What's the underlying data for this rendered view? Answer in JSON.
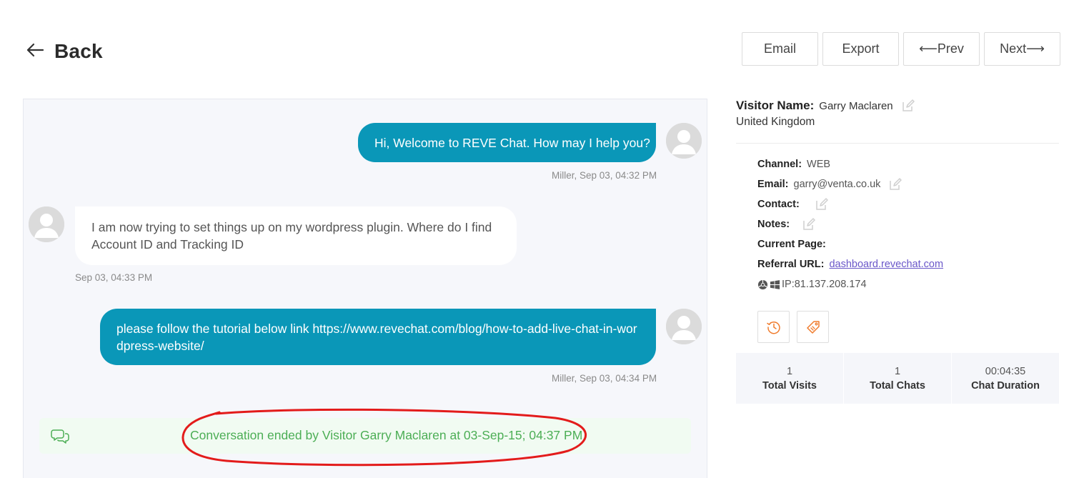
{
  "header": {
    "back_label": "Back"
  },
  "toolbar": {
    "email": "Email",
    "export": "Export",
    "prev": "⟵Prev",
    "next": "Next⟶"
  },
  "messages": [
    {
      "sender": "agent",
      "text": "Hi, Welcome to REVE Chat. How may I help you?",
      "meta": "Miller, Sep 03, 04:32 PM"
    },
    {
      "sender": "visitor",
      "text": "I am now trying to set things up on my wordpress plugin. Where do I find Account ID and Tracking ID",
      "meta": "Sep 03, 04:33 PM"
    },
    {
      "sender": "agent",
      "text": "please follow the tutorial below link https://www.revechat.com/blog/how-to-add-live-chat-in-wordpress-website/",
      "meta": "Miller, Sep 03, 04:34 PM"
    }
  ],
  "conversation_ended": {
    "text": "Conversation ended by Visitor Garry Maclaren at 03-Sep-15; 04:37 PM",
    "icon": "chat-bubbles-icon"
  },
  "visitor": {
    "name_label": "Visitor Name:",
    "name": "Garry Maclaren",
    "country": "United Kingdom",
    "channel_label": "Channel:",
    "channel": "WEB",
    "email_label": "Email:",
    "email": "garry@venta.co.uk",
    "contact_label": "Contact:",
    "notes_label": "Notes:",
    "current_page_label": "Current Page:",
    "referral_label": "Referral URL:",
    "referral": "dashboard.revechat.com",
    "ip": "IP:81.137.208.174"
  },
  "stats": [
    {
      "value": "1",
      "label": "Total Visits"
    },
    {
      "value": "1",
      "label": "Total Chats"
    },
    {
      "value": "00:04:35",
      "label": "Chat Duration"
    }
  ],
  "colors": {
    "agent_bubble": "#0a97b8",
    "ended_text": "#4cae55",
    "annotation": "#e31b1b",
    "action_icon": "#f07b2c"
  }
}
